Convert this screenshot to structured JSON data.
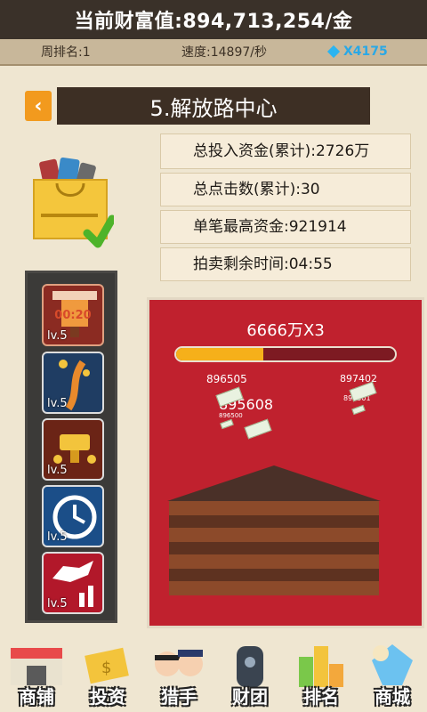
{
  "header": {
    "wealth": "当前财富值:894,713,254/金"
  },
  "stats": {
    "rank": "周排名:1",
    "speed": "速度:14897/秒",
    "gems": "X4175"
  },
  "location": {
    "back_icon": "‹",
    "title": "5.解放路中心"
  },
  "info": {
    "total_invest": "总投入资金(累计):2726万",
    "total_clicks": "总点击数(累计):30",
    "max_single": "单笔最高资金:921914",
    "auction_time": "拍卖剩余时间:04:55"
  },
  "skills": [
    {
      "icon": "cinema-icon",
      "level": "lv.5",
      "timer": "00:20"
    },
    {
      "icon": "coins-flow-icon",
      "level": "lv.5"
    },
    {
      "icon": "trophy-coins-icon",
      "level": "lv.5"
    },
    {
      "icon": "clock-icon",
      "level": "lv.5"
    },
    {
      "icon": "bull-chart-icon",
      "level": "lv.5"
    }
  ],
  "game": {
    "multiplier": "6666万X3",
    "progress": 0.4,
    "floating_numbers": [
      "896505",
      "895608",
      "897402",
      "896501",
      "896500"
    ]
  },
  "nav": [
    {
      "label": "商铺",
      "icon": "shop-icon"
    },
    {
      "label": "投资",
      "icon": "invest-icon"
    },
    {
      "label": "猎手",
      "icon": "hunter-icon"
    },
    {
      "label": "财团",
      "icon": "consortium-icon"
    },
    {
      "label": "排名",
      "icon": "ranking-icon"
    },
    {
      "label": "商城",
      "icon": "mall-icon"
    }
  ],
  "colors": {
    "accent": "#f29a1e",
    "header_bg": "#3a3129",
    "game_bg": "#c0212e",
    "progress_fill": "#f6b01a",
    "gem": "#2aa8e6"
  }
}
